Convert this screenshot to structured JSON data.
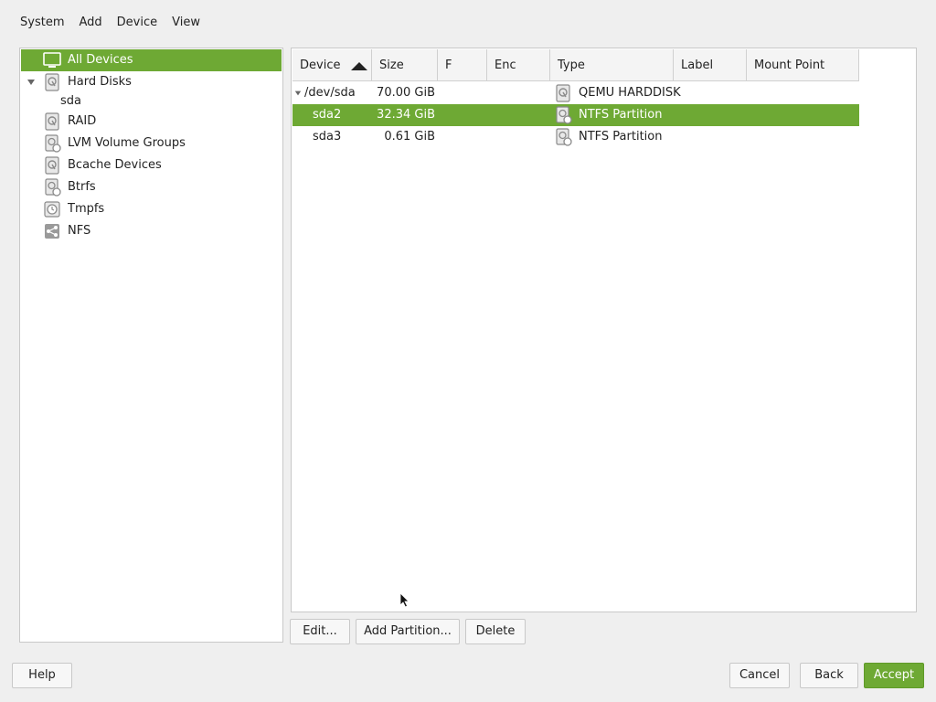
{
  "menu": {
    "items": [
      {
        "label": "System"
      },
      {
        "label": "Add"
      },
      {
        "label": "Device"
      },
      {
        "label": "View"
      }
    ]
  },
  "tree": {
    "all_devices": "All Devices",
    "hard_disks": "Hard Disks",
    "sda": "sda",
    "raid": "RAID",
    "lvm": "LVM Volume Groups",
    "bcache": "Bcache Devices",
    "btrfs": "Btrfs",
    "tmpfs": "Tmpfs",
    "nfs": "NFS"
  },
  "table": {
    "columns": [
      "Device",
      "Size",
      "F",
      "Enc",
      "Type",
      "Label",
      "Mount Point"
    ],
    "rows": [
      {
        "device": "/dev/sda",
        "size": "70.00 GiB",
        "type": "QEMU HARDDISK"
      },
      {
        "device": "sda2",
        "size": "32.34 GiB",
        "type": "NTFS Partition"
      },
      {
        "device": "sda3",
        "size": "0.61 GiB",
        "type": "NTFS Partition"
      }
    ]
  },
  "actions": {
    "edit": "Edit...",
    "add_partition": "Add Partition...",
    "delete": "Delete"
  },
  "footer": {
    "help": "Help",
    "cancel": "Cancel",
    "back": "Back",
    "accept": "Accept"
  },
  "colors": {
    "accent": "#6ea934",
    "background": "#efefef"
  }
}
